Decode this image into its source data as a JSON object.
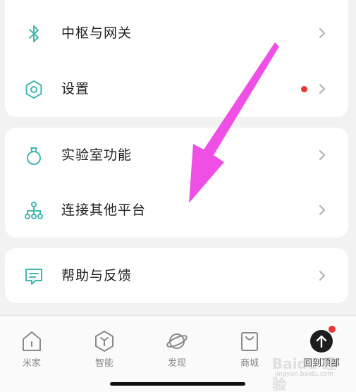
{
  "menu": {
    "group1": [
      {
        "label": "中枢与网关",
        "icon": "bluetooth-icon"
      },
      {
        "label": "设置",
        "icon": "settings-hexagon-icon",
        "badge": true
      }
    ],
    "group2": [
      {
        "label": "实验室功能",
        "icon": "flask-icon"
      },
      {
        "label": "连接其他平台",
        "icon": "network-tree-icon"
      }
    ],
    "group3": [
      {
        "label": "帮助与反馈",
        "icon": "feedback-message-icon"
      }
    ]
  },
  "tabbar": {
    "items": [
      {
        "label": "米家",
        "icon": "home-icon"
      },
      {
        "label": "智能",
        "icon": "smart-hexagon-icon"
      },
      {
        "label": "发现",
        "icon": "planet-icon"
      },
      {
        "label": "商城",
        "icon": "shopping-bag-icon"
      },
      {
        "label": "回到顶部",
        "icon": "arrow-up-circle-icon",
        "badge": true
      }
    ]
  },
  "watermark": {
    "text": "Baidu 经验",
    "sub": "jingyan.baidu.com"
  },
  "colors": {
    "accent": "#3fb8b0",
    "badge": "#e53935",
    "annotation_arrow": "#f04fe6"
  }
}
